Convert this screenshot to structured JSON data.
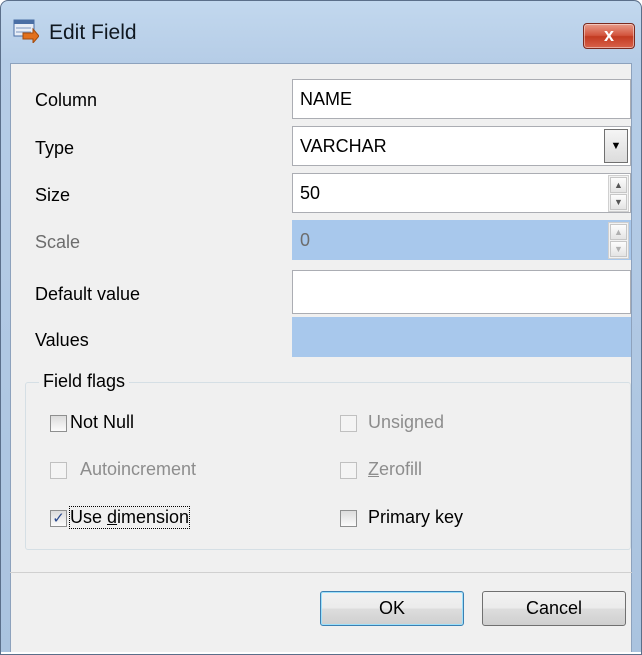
{
  "window": {
    "title": "Edit Field",
    "close_label": "x"
  },
  "form": {
    "column": {
      "label": "Column",
      "value": "NAME"
    },
    "type": {
      "label": "Type",
      "value": "VARCHAR"
    },
    "size": {
      "label": "Size",
      "value": "50"
    },
    "scale": {
      "label": "Scale",
      "value": "0",
      "disabled": true
    },
    "default_value": {
      "label": "Default value",
      "value": ""
    },
    "values": {
      "label": "Values",
      "value": "",
      "disabled": true
    }
  },
  "field_flags": {
    "title": "Field flags",
    "not_null": {
      "label": "Not Null",
      "checked": false,
      "enabled": true
    },
    "unsigned": {
      "label": "Unsigned",
      "checked": false,
      "enabled": false
    },
    "autoincrement": {
      "label": "Autoincrement",
      "checked": false,
      "enabled": false
    },
    "zerofill": {
      "label": "Zerofill",
      "checked": false,
      "enabled": false
    },
    "use_dimension": {
      "label": "Use dimension",
      "checked": true,
      "enabled": true
    },
    "primary_key": {
      "label": "Primary key",
      "checked": false,
      "enabled": true
    }
  },
  "buttons": {
    "ok": "OK",
    "cancel": "Cancel"
  },
  "icons": {
    "title_icon": "edit-field-icon",
    "close_icon": "close-icon",
    "dropdown_icon": "chevron-down-icon",
    "spin_up_icon": "spin-up-icon",
    "spin_down_icon": "spin-down-icon",
    "check_icon": "check-icon"
  },
  "colors": {
    "title_gradient_top": "#c2d8ee",
    "disabled_field": "#a8c8ec",
    "close_red": "#c23a21"
  }
}
